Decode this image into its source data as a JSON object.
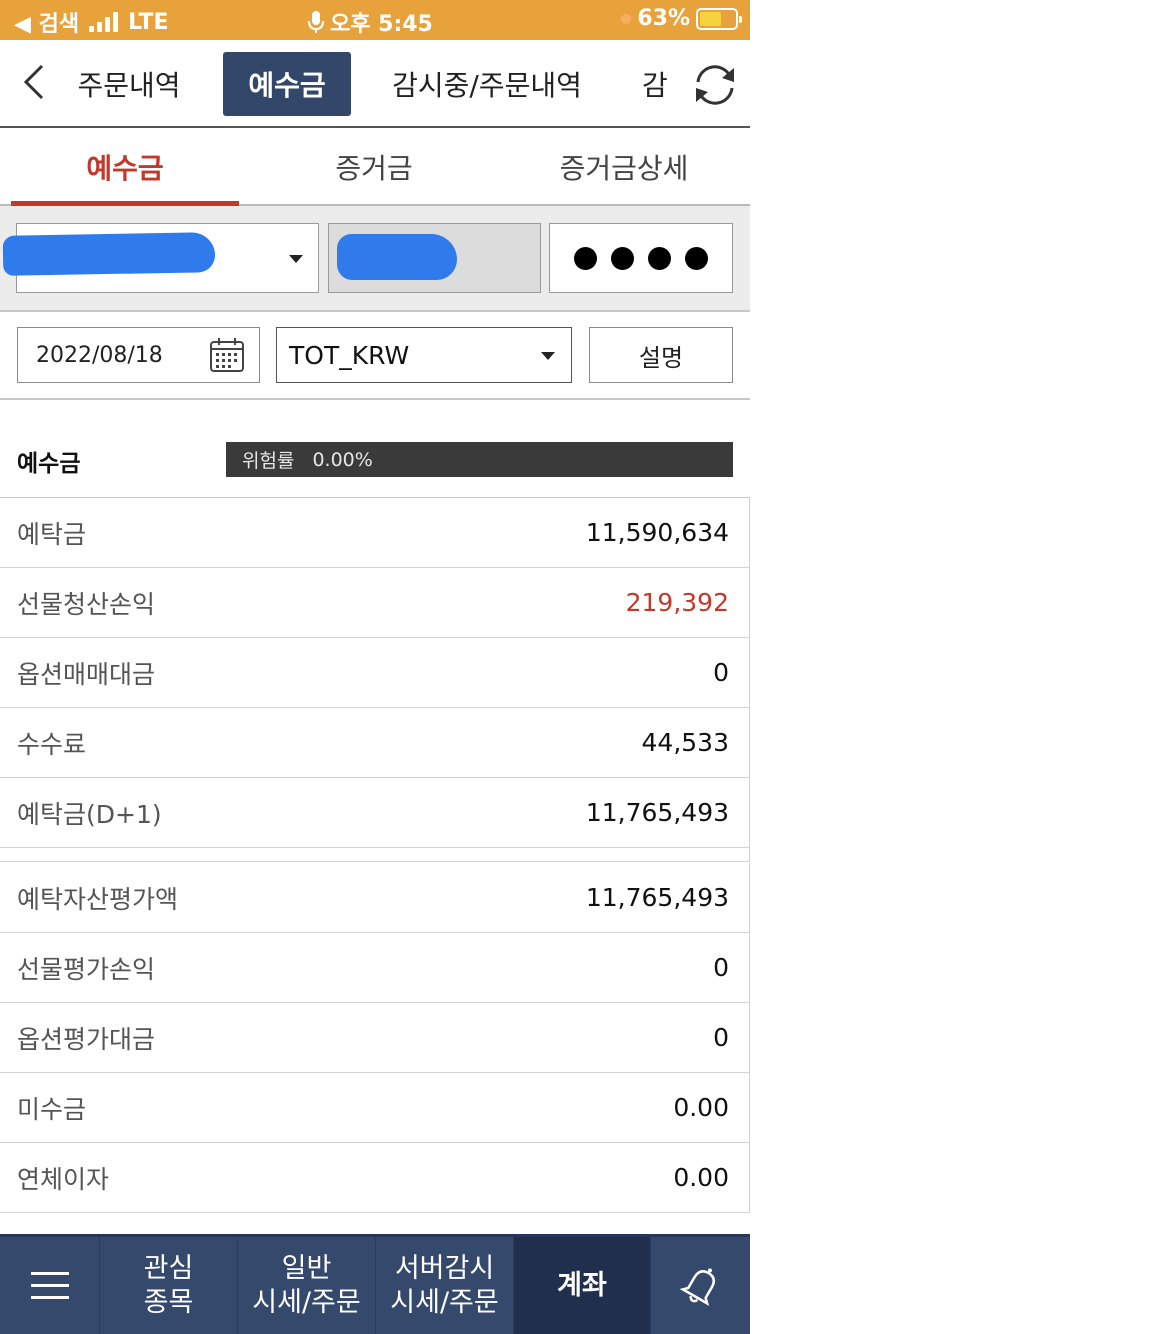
{
  "status_bar": {
    "back_app": "◀ 검색",
    "network": "LTE",
    "time": "오후 5:45",
    "battery": "63%",
    "battery_level": 0.63
  },
  "top_tabs": [
    "주문내역",
    "예수금",
    "감시중/주문내역",
    "감"
  ],
  "top_tabs_active": 1,
  "sub_tabs": [
    "예수금",
    "증거금",
    "증거금상세"
  ],
  "sub_tabs_active": 0,
  "filters": {
    "date": "2022/08/18",
    "currency": "TOT_KRW",
    "desc_button": "설명"
  },
  "section": {
    "title": "예수금",
    "risk_label": "위험률",
    "risk_value": "0.00%"
  },
  "group1": [
    {
      "label": "예탁금",
      "value": "11,590,634"
    },
    {
      "label": "선물청산손익",
      "value": "219,392",
      "highlight": true
    },
    {
      "label": "옵션매매대금",
      "value": "0"
    },
    {
      "label": "수수료",
      "value": "44,533"
    },
    {
      "label": "예탁금(D+1)",
      "value": "11,765,493"
    }
  ],
  "group2": [
    {
      "label": "예탁자산평가액",
      "value": "11,765,493"
    },
    {
      "label": "선물평가손익",
      "value": "0"
    },
    {
      "label": "옵션평가대금",
      "value": "0"
    },
    {
      "label": "미수금",
      "value": "0.00"
    },
    {
      "label": "연체이자",
      "value": "0.00"
    }
  ],
  "bottom_nav": {
    "watch": [
      "관심",
      "종목"
    ],
    "general": [
      "일반",
      "시세/주문"
    ],
    "server": [
      "서버감시",
      "시세/주문"
    ],
    "account": "계좌"
  },
  "colors": {
    "status_bar": "#e7a23b",
    "nav_active": "#33476a",
    "accent_red": "#c0392b",
    "bottom_nav": "#35496c"
  },
  "icons": [
    "back-chevron-icon",
    "refresh-icon",
    "calendar-icon",
    "menu-icon",
    "bell-icon",
    "mic-icon"
  ]
}
